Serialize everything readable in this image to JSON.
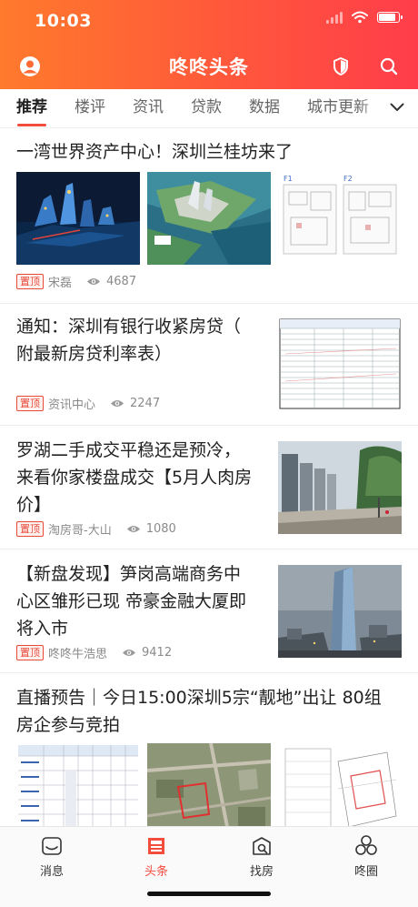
{
  "status": {
    "time": "10:03"
  },
  "header": {
    "title": "咚咚头条"
  },
  "tabs": [
    "推荐",
    "楼评",
    "资讯",
    "贷款",
    "数据",
    "城市更新"
  ],
  "articles": [
    {
      "title": "一湾世界资产中心！深圳兰桂坊来了",
      "pin": "置顶",
      "author": "宋磊",
      "views": "4687"
    },
    {
      "title_lines": [
        "通知：深圳有银行收紧房贷（",
        "附最新房贷利率表）"
      ],
      "pin": "置顶",
      "author": "资讯中心",
      "views": "2247"
    },
    {
      "title_lines": [
        "罗湖二手成交平稳还是预冷，",
        "来看你家楼盘成交【5月人肉房",
        "价】"
      ],
      "pin": "置顶",
      "author": "淘房哥-大山",
      "views": "1080"
    },
    {
      "title_lines": [
        "【新盘发现】笋岗高端商务中",
        "心区雏形已现  帝豪金融大厦即",
        "将入市"
      ],
      "pin": "置顶",
      "author": "咚咚牛浩思",
      "views": "9412"
    },
    {
      "title_lines": [
        "直播预告｜今日15:00深圳5宗“靓地”出让 80组",
        "房企参与竞拍"
      ]
    }
  ],
  "tabbar": [
    {
      "label": "消息",
      "icon": "message-icon"
    },
    {
      "label": "头条",
      "icon": "headline-icon"
    },
    {
      "label": "找房",
      "icon": "find-house-icon"
    },
    {
      "label": "咚圈",
      "icon": "circle-community-icon"
    }
  ],
  "colors": {
    "accent": "#f24c3d",
    "header_start": "#ff7a2c",
    "header_end": "#ff3d4a"
  }
}
